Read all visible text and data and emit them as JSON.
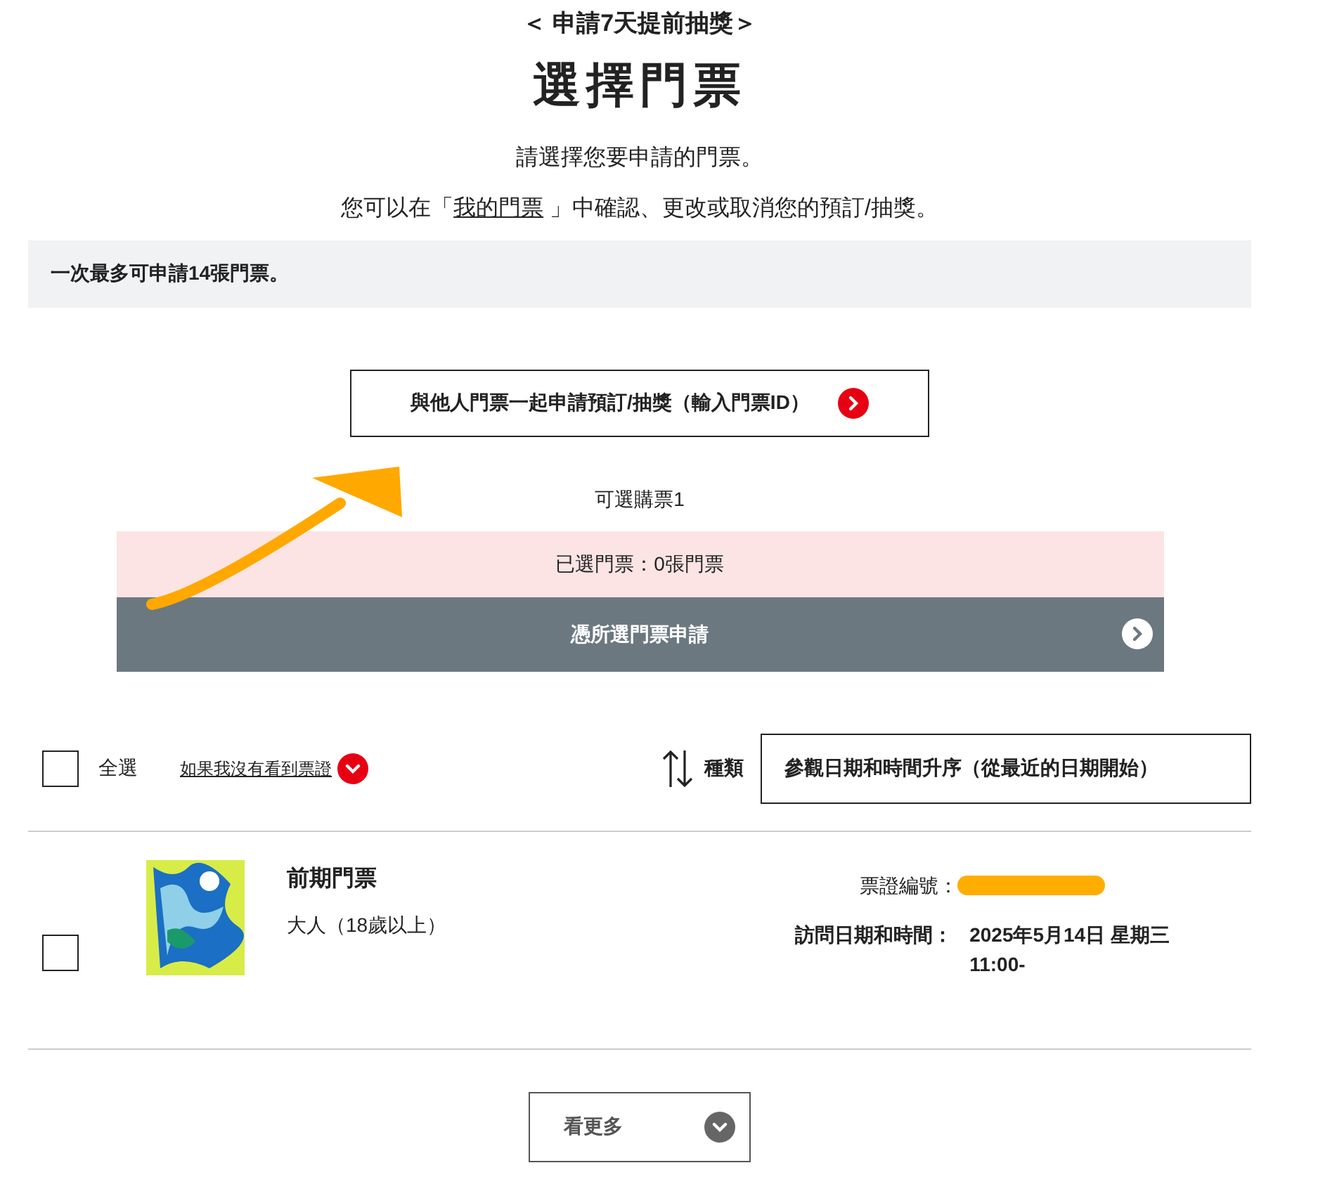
{
  "header": {
    "subtitle": "＜ 申請7天提前抽獎＞",
    "title": "選擇門票"
  },
  "intro": {
    "line1": "請選擇您要申請的門票。",
    "line2_before": "您可以在「",
    "line2_link": "我的門票",
    "line2_after": " 」中確認、更改或取消您的預訂/抽獎。"
  },
  "notice": "一次最多可申請14張門票。",
  "group_button": "與他人門票一起申請預訂/抽獎（輸入門票ID）",
  "available": "可選購票1",
  "selected_summary": "已選門票：0張門票",
  "apply_button": {
    "label": "憑所選門票申請",
    "disabled": true
  },
  "toolbar": {
    "select_all": {
      "label": "全選",
      "checked": false
    },
    "help_link": "如果我沒有看到票證",
    "sort_label": "種類",
    "sort_value": "參觀日期和時間升序（從最近的日期開始）"
  },
  "tickets": [
    {
      "checked": false,
      "name": "前期門票",
      "type": "大人（18歲以上）",
      "number_label": "票證編號：",
      "visit_label": "訪問日期和時間：",
      "visit_date": "2025年5月14日 星期三",
      "visit_time": "11:00-"
    }
  ],
  "more_button": "看更多"
}
